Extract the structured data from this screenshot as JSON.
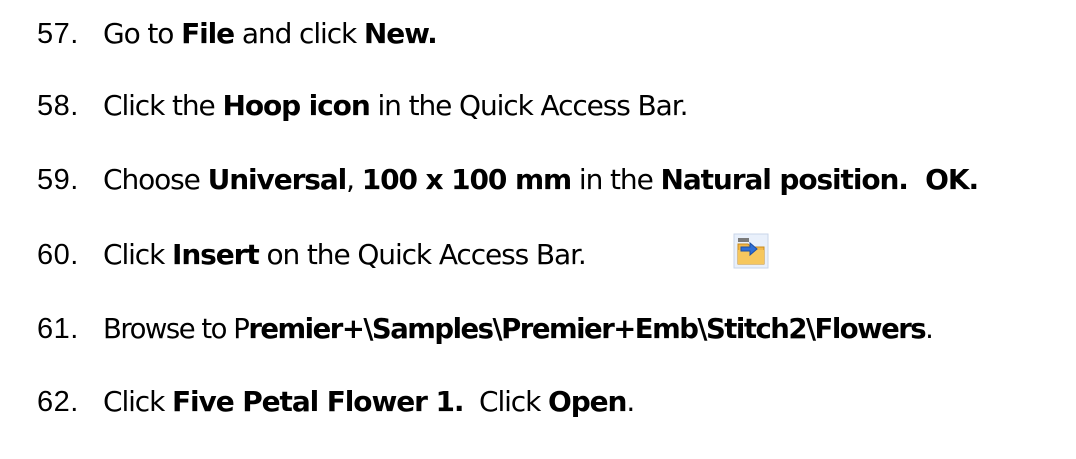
{
  "steps": [
    {
      "number": "57.",
      "parts": [
        {
          "text": "Go to ",
          "bold": false
        },
        {
          "text": "File",
          "bold": true
        },
        {
          "text": " and click ",
          "bold": false
        },
        {
          "text": "New.",
          "bold": true
        }
      ]
    },
    {
      "number": "58.",
      "parts": [
        {
          "text": "Click the ",
          "bold": false
        },
        {
          "text": "Hoop icon",
          "bold": true
        },
        {
          "text": " in the Quick Access Bar.",
          "bold": false
        }
      ]
    },
    {
      "number": "59.",
      "parts": [
        {
          "text": "Choose ",
          "bold": false
        },
        {
          "text": "Universal",
          "bold": true
        },
        {
          "text": ", ",
          "bold": false
        },
        {
          "text": "100 x 100 mm",
          "bold": true
        },
        {
          "text": " in the ",
          "bold": false
        },
        {
          "text": "Natural position.  OK.",
          "bold": true
        }
      ]
    },
    {
      "number": "60.",
      "parts": [
        {
          "text": "Click ",
          "bold": false
        },
        {
          "text": "Insert",
          "bold": true
        },
        {
          "text": " on the Quick Access Bar.",
          "bold": false
        }
      ],
      "icon": "insert-icon"
    },
    {
      "number": "61.",
      "parts": [
        {
          "text": "Browse to P",
          "bold": false
        },
        {
          "text": "remier+\\Samples\\Premier+Emb\\Stitch2\\Flowers",
          "bold": true
        },
        {
          "text": ".",
          "bold": false
        }
      ]
    },
    {
      "number": "62.",
      "parts": [
        {
          "text": "Click ",
          "bold": false
        },
        {
          "text": "Five Petal Flower 1.",
          "bold": true
        },
        {
          "text": "  Click ",
          "bold": false
        },
        {
          "text": "Open",
          "bold": true
        },
        {
          "text": ".",
          "bold": false
        }
      ]
    }
  ],
  "colors": {
    "text": "#000000",
    "background": "#ffffff",
    "icon_folder": "#f2b84b",
    "icon_arrow": "#2f6fd6"
  }
}
